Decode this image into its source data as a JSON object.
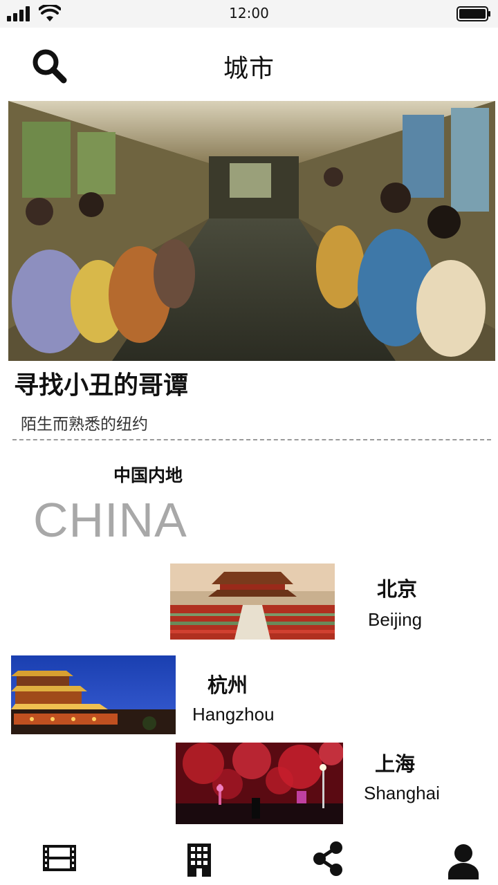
{
  "status_bar": {
    "time": "12:00"
  },
  "header": {
    "title": "城市",
    "search_icon": "search-icon"
  },
  "hero": {
    "title": "寻找小丑的哥谭",
    "subtitle": "陌生而熟悉的纽约",
    "image": "train-carriage-passengers-photo"
  },
  "section": {
    "title_cn": "中国内地",
    "title_en": "CHINA"
  },
  "cities": [
    {
      "name_cn": "北京",
      "name_en": "Beijing",
      "image": "forbidden-city-photo"
    },
    {
      "name_cn": "杭州",
      "name_en": "Hangzhou",
      "image": "night-pagoda-photo"
    },
    {
      "name_cn": "上海",
      "name_en": "Shanghai",
      "image": "fireworks-skyline-photo"
    }
  ],
  "tab_bar": {
    "items": [
      {
        "icon": "film-icon"
      },
      {
        "icon": "building-icon"
      },
      {
        "icon": "share-icon"
      },
      {
        "icon": "user-icon"
      }
    ]
  },
  "colors": {
    "status_bar_bg": "#f4f4f4",
    "text": "#111111",
    "section_en": "#a8a8a8",
    "divider": "#9a9a9a"
  }
}
